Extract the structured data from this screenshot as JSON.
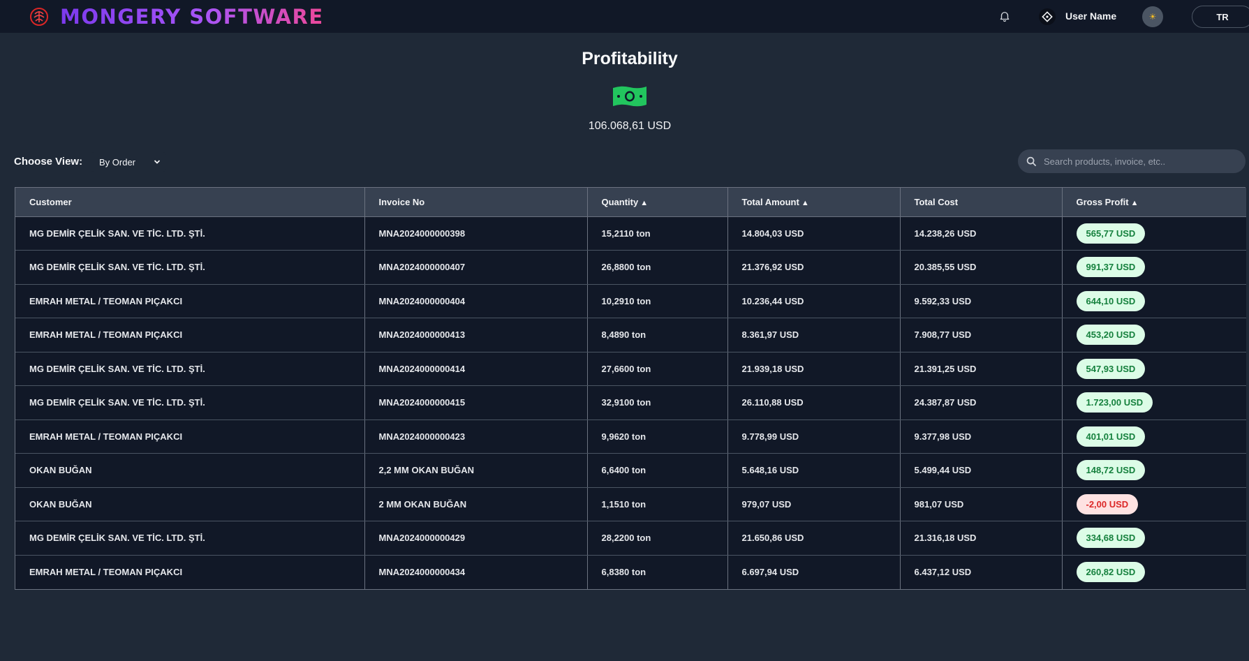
{
  "app": {
    "brand": "MONGERY SOFTWARE"
  },
  "header": {
    "user_name": "User Name",
    "language": "TR"
  },
  "page": {
    "title": "Profitability",
    "total": "106.068,61 USD"
  },
  "controls": {
    "choose_view_label": "Choose View:",
    "view_selected": "By Order",
    "search_placeholder": "Search products, invoice, etc.."
  },
  "table": {
    "columns": [
      {
        "label": "Customer",
        "sort": ""
      },
      {
        "label": "Invoice No",
        "sort": ""
      },
      {
        "label": "Quantity",
        "sort": "▲"
      },
      {
        "label": "Total Amount",
        "sort": "▲"
      },
      {
        "label": "Total Cost",
        "sort": ""
      },
      {
        "label": "Gross Profit",
        "sort": "▲"
      }
    ],
    "rows": [
      {
        "customer": "MG DEMİR ÇELİK SAN. VE TİC. LTD. ŞTİ.",
        "invoice": "MNA2024000000398",
        "quantity": "15,2110 ton",
        "amount": "14.804,03 USD",
        "cost": "14.238,26 USD",
        "profit": "565,77 USD",
        "status": "positive"
      },
      {
        "customer": "MG DEMİR ÇELİK SAN. VE TİC. LTD. ŞTİ.",
        "invoice": "MNA2024000000407",
        "quantity": "26,8800 ton",
        "amount": "21.376,92 USD",
        "cost": "20.385,55 USD",
        "profit": "991,37 USD",
        "status": "positive"
      },
      {
        "customer": "EMRAH METAL / TEOMAN PIÇAKCI",
        "invoice": "MNA2024000000404",
        "quantity": "10,2910 ton",
        "amount": "10.236,44 USD",
        "cost": "9.592,33 USD",
        "profit": "644,10 USD",
        "status": "positive"
      },
      {
        "customer": "EMRAH METAL / TEOMAN PIÇAKCI",
        "invoice": "MNA2024000000413",
        "quantity": "8,4890 ton",
        "amount": "8.361,97 USD",
        "cost": "7.908,77 USD",
        "profit": "453,20 USD",
        "status": "positive"
      },
      {
        "customer": "MG DEMİR ÇELİK SAN. VE TİC. LTD. ŞTİ.",
        "invoice": "MNA2024000000414",
        "quantity": "27,6600 ton",
        "amount": "21.939,18 USD",
        "cost": "21.391,25 USD",
        "profit": "547,93 USD",
        "status": "positive"
      },
      {
        "customer": "MG DEMİR ÇELİK SAN. VE TİC. LTD. ŞTİ.",
        "invoice": "MNA2024000000415",
        "quantity": "32,9100 ton",
        "amount": "26.110,88 USD",
        "cost": "24.387,87 USD",
        "profit": "1.723,00 USD",
        "status": "positive"
      },
      {
        "customer": "EMRAH METAL / TEOMAN PIÇAKCI",
        "invoice": "MNA2024000000423",
        "quantity": "9,9620 ton",
        "amount": "9.778,99 USD",
        "cost": "9.377,98 USD",
        "profit": "401,01 USD",
        "status": "positive"
      },
      {
        "customer": "OKAN BUĞAN",
        "invoice": "2,2 MM OKAN BUĞAN",
        "quantity": "6,6400 ton",
        "amount": "5.648,16 USD",
        "cost": "5.499,44 USD",
        "profit": "148,72 USD",
        "status": "positive"
      },
      {
        "customer": "OKAN BUĞAN",
        "invoice": "2 MM OKAN BUĞAN",
        "quantity": "1,1510 ton",
        "amount": "979,07 USD",
        "cost": "981,07 USD",
        "profit": "-2,00 USD",
        "status": "negative"
      },
      {
        "customer": "MG DEMİR ÇELİK SAN. VE TİC. LTD. ŞTİ.",
        "invoice": "MNA2024000000429",
        "quantity": "28,2200 ton",
        "amount": "21.650,86 USD",
        "cost": "21.316,18 USD",
        "profit": "334,68 USD",
        "status": "positive"
      },
      {
        "customer": "EMRAH METAL / TEOMAN PIÇAKCI",
        "invoice": "MNA2024000000434",
        "quantity": "6,8380 ton",
        "amount": "6.697,94 USD",
        "cost": "6.437,12 USD",
        "profit": "260,82 USD",
        "status": "positive"
      }
    ]
  },
  "icons": {
    "logo": "brain-logo-icon",
    "notification": "bell-icon",
    "user": "diamond-user-icon",
    "theme": "sun-icon",
    "money": "banknote-icon",
    "search": "search-icon",
    "dropdown": "chevron-down-icon"
  },
  "colors": {
    "background": "#1f2937",
    "topbar": "#111827",
    "profit_positive_bg": "#dcfce7",
    "profit_positive_text": "#15803d",
    "profit_negative_bg": "#fee2e2",
    "profit_negative_text": "#dc2626",
    "money_green": "#22c55e"
  }
}
